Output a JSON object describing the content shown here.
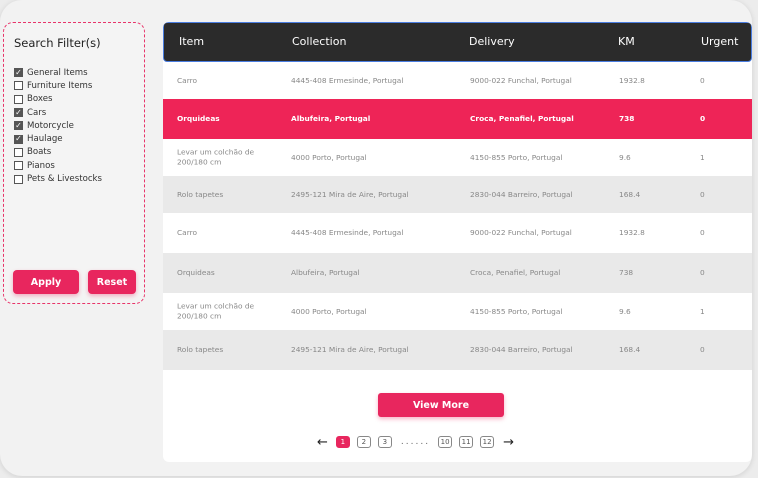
{
  "filter": {
    "title": "Search Filter(s)",
    "items": [
      {
        "label": "General Items",
        "checked": true
      },
      {
        "label": "Furniture Items",
        "checked": false
      },
      {
        "label": "Boxes",
        "checked": false
      },
      {
        "label": "Cars",
        "checked": true
      },
      {
        "label": "Motorcycle",
        "checked": true
      },
      {
        "label": "Haulage",
        "checked": true
      },
      {
        "label": "Boats",
        "checked": false
      },
      {
        "label": "Pianos",
        "checked": false
      },
      {
        "label": "Pets & Livestocks",
        "checked": false
      }
    ],
    "apply_label": "Apply",
    "reset_label": "Reset"
  },
  "table": {
    "headers": [
      "Item",
      "Collection",
      "Delivery",
      "KM",
      "Urgent"
    ],
    "rows": [
      {
        "item": "Carro",
        "collection": "4445-408 Ermesinde, Portugal",
        "delivery": "9000-022 Funchal, Portugal",
        "km": "1932.8",
        "urgent": "0",
        "active": false
      },
      {
        "item": "Orquideas",
        "collection": "Albufeira, Portugal",
        "delivery": "Croca, Penafiel, Portugal",
        "km": "738",
        "urgent": "0",
        "active": true
      },
      {
        "item": "Levar um colchão de 200/180 cm",
        "collection": "4000 Porto, Portugal",
        "delivery": "4150-855 Porto, Portugal",
        "km": "9.6",
        "urgent": "1",
        "active": false
      },
      {
        "item": "Rolo tapetes",
        "collection": "2495-121 Mira de Aire, Portugal",
        "delivery": "2830-044 Barreiro, Portugal",
        "km": "168.4",
        "urgent": "0",
        "active": false
      },
      {
        "item": "Carro",
        "collection": "4445-408 Ermesinde, Portugal",
        "delivery": "9000-022 Funchal, Portugal",
        "km": "1932.8",
        "urgent": "0",
        "active": false
      },
      {
        "item": "Orquideas",
        "collection": "Albufeira, Portugal",
        "delivery": "Croca, Penafiel, Portugal",
        "km": "738",
        "urgent": "0",
        "active": false
      },
      {
        "item": "Levar um colchão de 200/180 cm",
        "collection": "4000 Porto, Portugal",
        "delivery": "4150-855 Porto, Portugal",
        "km": "9.6",
        "urgent": "1",
        "active": false
      },
      {
        "item": "Rolo tapetes",
        "collection": "2495-121 Mira de Aire, Portugal",
        "delivery": "2830-044 Barreiro, Portugal",
        "km": "168.4",
        "urgent": "0",
        "active": false
      }
    ],
    "view_more_label": "View More"
  },
  "pagination": {
    "prev_icon": "arrow-left-icon",
    "next_icon": "arrow-right-icon",
    "pages_start": [
      "1",
      "2",
      "3"
    ],
    "ellipsis": "......",
    "pages_end": [
      "10",
      "11",
      "12"
    ],
    "current": "1"
  },
  "colors": {
    "accent": "#e8265e",
    "header_bg": "#2b2b2b",
    "header_border": "#4a7de0"
  }
}
